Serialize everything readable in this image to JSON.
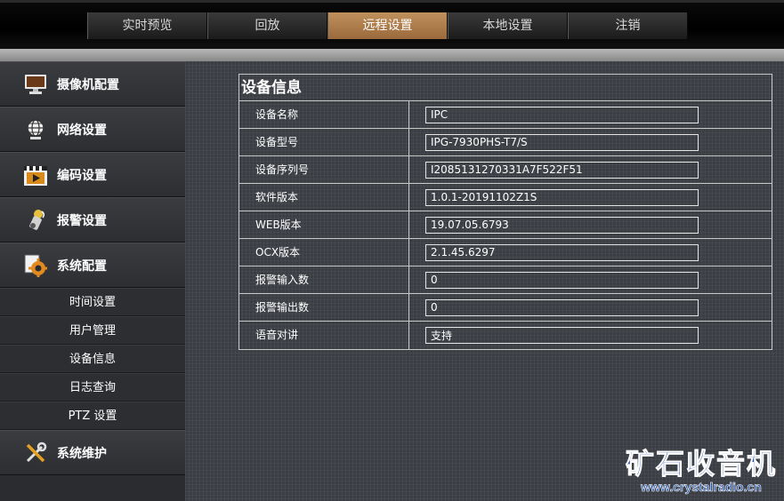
{
  "nav": {
    "tabs": [
      {
        "label": "实时预览"
      },
      {
        "label": "回放"
      },
      {
        "label": "远程设置"
      },
      {
        "label": "本地设置"
      },
      {
        "label": "注销"
      }
    ],
    "active_index": 2
  },
  "sidebar": {
    "items": [
      {
        "label": "摄像机配置",
        "icon": "monitor-icon"
      },
      {
        "label": "网络设置",
        "icon": "globe-icon"
      },
      {
        "label": "编码设置",
        "icon": "video-clapper-icon"
      },
      {
        "label": "报警设置",
        "icon": "alarm-icon"
      },
      {
        "label": "系统配置",
        "icon": "system-gear-icon"
      }
    ],
    "sub_items": [
      {
        "label": "时间设置"
      },
      {
        "label": "用户管理"
      },
      {
        "label": "设备信息"
      },
      {
        "label": "日志查询"
      },
      {
        "label": "PTZ 设置"
      }
    ],
    "maintenance": {
      "label": "系统维护",
      "icon": "tools-icon"
    }
  },
  "device_info": {
    "title": "设备信息",
    "rows": [
      {
        "key": "设备名称",
        "value": "IPC"
      },
      {
        "key": "设备型号",
        "value": "IPG-7930PHS-T7/S"
      },
      {
        "key": "设备序列号",
        "value": "I2085131270331A7F522F51"
      },
      {
        "key": "软件版本",
        "value": "1.0.1-20191102Z1S"
      },
      {
        "key": "WEB版本",
        "value": "19.07.05.6793"
      },
      {
        "key": "OCX版本",
        "value": "2.1.45.6297"
      },
      {
        "key": "报警输入数",
        "value": "0"
      },
      {
        "key": "报警输出数",
        "value": "0"
      },
      {
        "key": "语音对讲",
        "value": "支持"
      }
    ]
  },
  "watermark": {
    "title": "矿石收音机",
    "url": "www.crystalradio.cn"
  },
  "colors": {
    "active_tab": "#b07e4c",
    "watermark_blue": "#1e4fa8"
  }
}
